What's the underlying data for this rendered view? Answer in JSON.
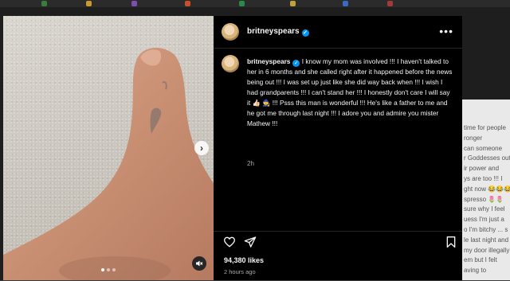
{
  "post": {
    "username": "britneyspears",
    "caption_username": "britneyspears",
    "caption": "I know my mom was involved !!! I haven't talked to her in 6 months and she called right after it happened before the news being out !!! I was set up just like she did way back when !!! I wish I had grandparents !!! I can't stand her !!! I honestly don't care I will say it 👍🏻 🧙 !!! Psss this man is wonderful !!! He's like a father to me and he got me through last night !!! I adore you and admire you mister Mathew !!!",
    "time_ago": "2h",
    "likes": "94,380 likes",
    "posted": "2 hours ago"
  },
  "icons": {
    "verified": "verified-badge-icon",
    "more": "more-options-icon",
    "like": "heart-icon",
    "share": "share-icon",
    "save": "bookmark-icon",
    "next": "chevron-right-icon",
    "mute": "muted-speaker-icon"
  },
  "background_comments": [
    "time for people",
    "ronger",
    "can someone",
    "r Goddesses out",
    "ir power and",
    "ys are too !!! I",
    "ght now 😂😂😂",
    "spresso 🌷🌷",
    "sure why I feel",
    "uess I'm just a",
    "o I'm bitchy ... s",
    "le last night and",
    "my door illegally",
    "em but I felt",
    "aving to"
  ],
  "colors": {
    "accent": "#0095f6",
    "panel_bg": "#000000",
    "muted_text": "#a8a8a8"
  }
}
